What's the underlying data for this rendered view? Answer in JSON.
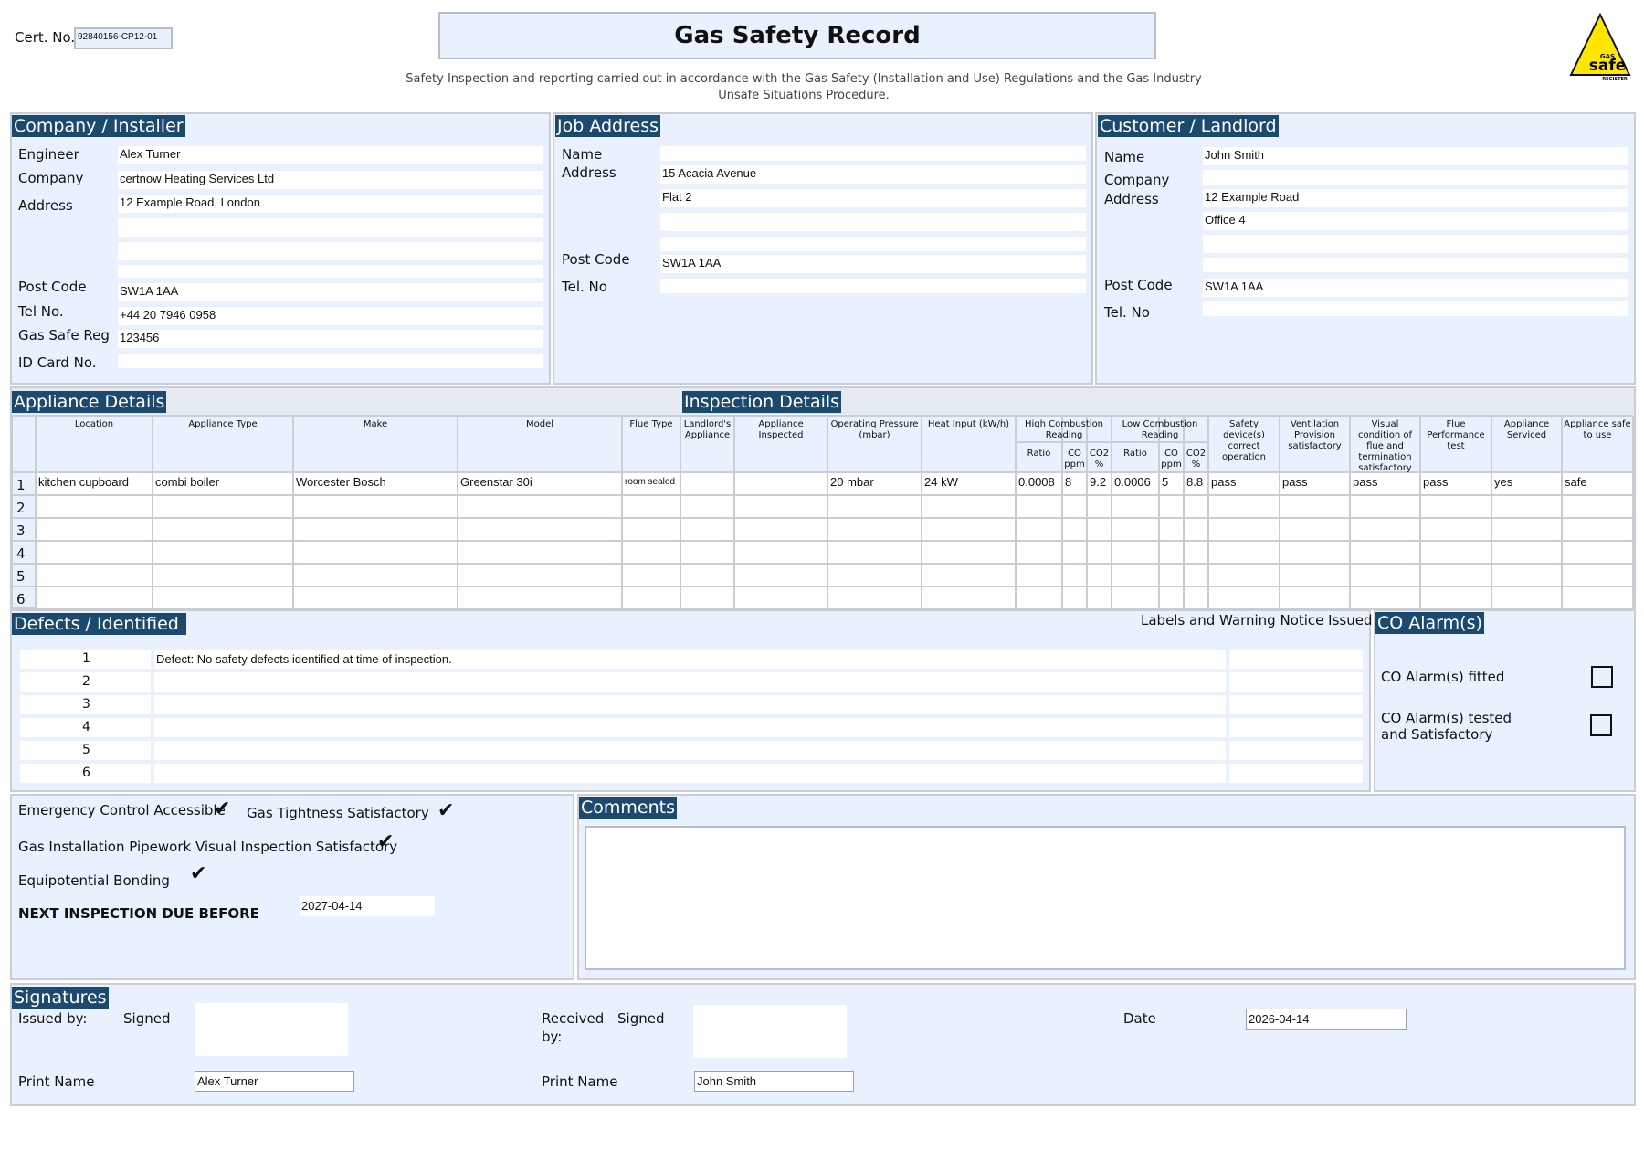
{
  "header": {
    "cert_label": "Cert. No.",
    "cert_no": "92840156-CP12-01",
    "title": "Gas Safety Record",
    "subtitle": "Safety Inspection and reporting carried out in accordance with the Gas Safety (Installation and Use) Regulations and the Gas Industry Unsafe Situations Procedure.",
    "logo": {
      "top": "GAS",
      "main": "safe",
      "bottom": "REGISTER",
      "color": "#ffe600"
    }
  },
  "company": {
    "title": "Company / Installer",
    "engineer_label": "Engineer",
    "engineer": "Alex Turner",
    "company_label": "Company",
    "company": "certnow Heating Services Ltd",
    "address_label": "Address",
    "address1": "12 Example Road, London",
    "address2": "",
    "address3": "",
    "postcode_label": "Post Code",
    "postcode": "SW1A 1AA",
    "tel_label": "Tel No.",
    "tel": "+44 20 7946 0958",
    "gassafe_label": "Gas Safe Reg",
    "gassafe": "123456",
    "idcard_label": "ID Card No.",
    "idcard": ""
  },
  "job": {
    "title": "Job Address",
    "name_label": "Name",
    "name": "",
    "address_label": "Address",
    "address1": "15 Acacia Avenue",
    "address2": "Flat 2",
    "address3": "",
    "address4": "",
    "postcode_label": "Post Code",
    "postcode": "SW1A 1AA",
    "tel_label": "Tel. No",
    "tel": ""
  },
  "customer": {
    "title": "Customer / Landlord",
    "name_label": "Name",
    "name": "John Smith",
    "company_label": "Company",
    "company": "",
    "address_label": "Address",
    "address1": "12 Example Road",
    "address2": "Office 4",
    "address3": "",
    "address4": "",
    "postcode_label": "Post Code",
    "postcode": "SW1A 1AA",
    "tel_label": "Tel. No",
    "tel": ""
  },
  "appliances": {
    "title": "Appliance Details",
    "inspection_title": "Inspection Details",
    "headers": {
      "location": "Location",
      "type": "Appliance Type",
      "make": "Make",
      "model": "Model",
      "flue": "Flue Type",
      "landlords": "Landlord's Appliance",
      "inspected": "Appliance Inspected",
      "pressure": "Operating Pressure (mbar)",
      "heat": "Heat Input (kW/h)",
      "high": "High Combustion Reading",
      "low": "Low Combustion Reading",
      "ratio": "Ratio",
      "co": "CO ppm",
      "co2": "CO2 %",
      "safety": "Safety device(s) correct operation",
      "ventilation": "Ventilation Provision satisfactory",
      "visual": "Visual condition of flue and termination satisfactory",
      "flueperf": "Flue Performance test",
      "serviced": "Appliance Serviced",
      "safe": "Appliance safe to use"
    },
    "rows": [
      {
        "n": "1",
        "location": "kitchen cupboard",
        "type": "combi boiler",
        "make": "Worcester Bosch",
        "model": "Greenstar 30i",
        "flue": "room sealed",
        "landlords": "",
        "inspected": "",
        "pressure": "20 mbar",
        "heat": "24 kW",
        "h_ratio": "0.0008",
        "h_co": "8",
        "h_co2": "9.2",
        "l_ratio": "0.0006",
        "l_co": "5",
        "l_co2": "8.8",
        "safety": "pass",
        "ventilation": "pass",
        "visual": "pass",
        "flueperf": "pass",
        "serviced": "yes",
        "safe": "safe"
      },
      {
        "n": "2"
      },
      {
        "n": "3"
      },
      {
        "n": "4"
      },
      {
        "n": "5"
      },
      {
        "n": "6"
      }
    ]
  },
  "defects": {
    "title": "Defects / Identified",
    "labels_header": "Labels and Warning Notice Issued",
    "rows": [
      {
        "n": "1",
        "text": "Defect: No safety defects identified at time of inspection.",
        "labels": ""
      },
      {
        "n": "2",
        "text": "",
        "labels": ""
      },
      {
        "n": "3",
        "text": "",
        "labels": ""
      },
      {
        "n": "4",
        "text": "",
        "labels": ""
      },
      {
        "n": "5",
        "text": "",
        "labels": ""
      },
      {
        "n": "6",
        "text": "",
        "labels": ""
      }
    ]
  },
  "co_alarms": {
    "title": "CO Alarm(s)",
    "fitted_label": "CO Alarm(s) fitted",
    "tested_label1": "CO Alarm(s) tested",
    "tested_label2": "and Satisfactory"
  },
  "checks": {
    "emergency_label": "Emergency Control Accessible",
    "tightness_label": "Gas Tightness Satisfactory",
    "pipework_label": "Gas Installation Pipework Visual Inspection Satisfactory",
    "bonding_label": "Equipotential Bonding",
    "next_label": "NEXT INSPECTION DUE BEFORE",
    "next_date": "2027-04-14",
    "check_glyph": "✔"
  },
  "comments": {
    "title": "Comments",
    "text": ""
  },
  "signatures": {
    "title": "Signatures",
    "issued_label": "Issued by:",
    "signed_label": "Signed",
    "received_label1": "Received",
    "received_label2": "by:",
    "date_label": "Date",
    "date": "2026-04-14",
    "print_label": "Print Name",
    "issued_name": "Alex Turner",
    "received_name": "John Smith"
  }
}
